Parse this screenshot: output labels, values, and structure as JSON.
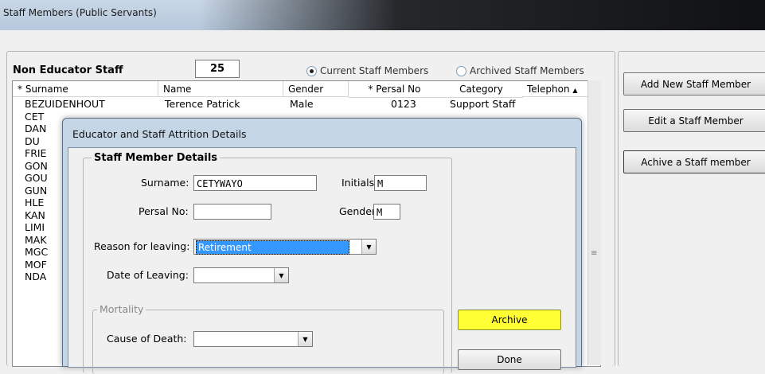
{
  "window": {
    "title": "Staff Members (Public Servants)"
  },
  "panel": {
    "heading": "Non Educator Staff",
    "count": "25",
    "radio_current": "Current Staff Members",
    "radio_archived": "Archived Staff Members",
    "selected_filter": "Current Staff Members"
  },
  "grid": {
    "columns": [
      "* Surname",
      "Name",
      "Gender",
      "* Persal No",
      "Category",
      "Telephon"
    ],
    "rows": [
      [
        "BEZUIDENHOUT",
        "Terence Patrick",
        "Male",
        "0123",
        "Support Staff",
        ""
      ],
      [
        "CET",
        "",
        "",
        "",
        "",
        ""
      ],
      [
        "DAN",
        "",
        "",
        "",
        "",
        ""
      ],
      [
        "DU",
        "",
        "",
        "",
        "",
        ""
      ],
      [
        "FRIE",
        "",
        "",
        "",
        "",
        ""
      ],
      [
        "GON",
        "",
        "",
        "",
        "",
        ""
      ],
      [
        "GOU",
        "",
        "",
        "",
        "",
        ""
      ],
      [
        "GUN",
        "",
        "",
        "",
        "",
        ""
      ],
      [
        "HLE",
        "",
        "",
        "",
        "",
        ""
      ],
      [
        "KAN",
        "",
        "",
        "",
        "",
        ""
      ],
      [
        "LIMI",
        "",
        "",
        "",
        "",
        ""
      ],
      [
        "MAK",
        "",
        "",
        "",
        "",
        ""
      ],
      [
        "MGC",
        "",
        "",
        "",
        "",
        ""
      ],
      [
        "MOF",
        "",
        "",
        "",
        "",
        ""
      ],
      [
        "NDA",
        "",
        "",
        "",
        "",
        ""
      ]
    ]
  },
  "actions": {
    "add": "Add New Staff Member",
    "edit": "Edit a Staff Member",
    "archive": "Achive a Staff member"
  },
  "dialog": {
    "title": "Educator and Staff Attrition Details",
    "group_details": "Staff Member Details",
    "surname_label": "Surname:",
    "surname_value": "CETYWAYO",
    "initials_label": "Initials:",
    "initials_value": "M",
    "persal_label": "Persal No:",
    "persal_value": "",
    "gender_label": "Gender:",
    "gender_value": "M",
    "reason_label": "Reason for leaving:",
    "reason_value": "Retirement",
    "date_label": "Date of Leaving:",
    "date_value": "",
    "group_mortality": "Mortality",
    "cause_label": "Cause of Death:",
    "cause_value": "",
    "archive_button": "Archive",
    "done_button": "Done"
  },
  "colors": {
    "archive_button_bg": "#ffff33",
    "selection_bg": "#3399ff"
  }
}
